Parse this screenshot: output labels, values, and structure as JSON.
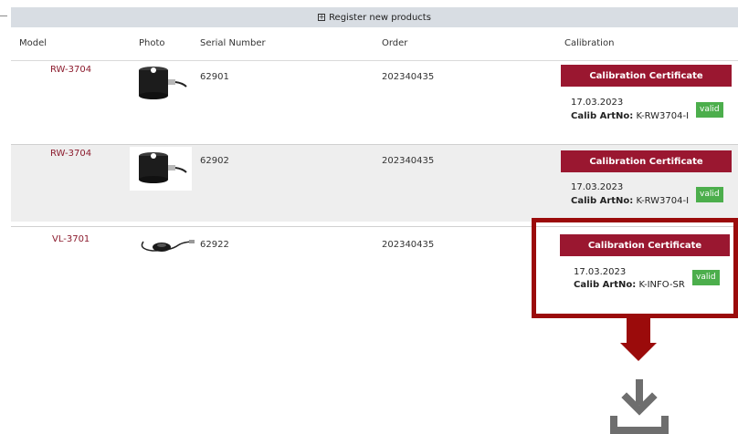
{
  "register": {
    "label": "Register new products",
    "icon": "plus-box-icon"
  },
  "columns": {
    "model": "Model",
    "photo": "Photo",
    "serial": "Serial Number",
    "order": "Order",
    "calibration": "Calibration"
  },
  "rows": [
    {
      "model": "RW-3704",
      "serial": "62901",
      "order": "202340435",
      "cert_label": "Calibration Certificate",
      "cal_date": "17.03.2023",
      "art_label": "Calib ArtNo:",
      "art_no": "K-RW3704-I",
      "status": "valid",
      "photo": "sensor-cylinder-photo"
    },
    {
      "model": "RW-3704",
      "serial": "62902",
      "order": "202340435",
      "cert_label": "Calibration Certificate",
      "cal_date": "17.03.2023",
      "art_label": "Calib ArtNo:",
      "art_no": "K-RW3704-I",
      "status": "valid",
      "photo": "sensor-cylinder-photo"
    },
    {
      "model": "VL-3701",
      "serial": "62922",
      "order": "202340435",
      "cert_label": "Calibration Certificate",
      "cal_date": "17.03.2023",
      "art_label": "Calib ArtNo:",
      "art_no": "K-INFO-SR",
      "status": "valid",
      "photo": "sensor-disc-cable-photo"
    }
  ],
  "colors": {
    "accent": "#9a1730",
    "model_link": "#8c1c2e",
    "valid": "#4cae4c",
    "annotation": "#9b0b0b",
    "header_bar": "#d8dde3"
  },
  "annotation": {
    "arrow": "down-arrow-icon",
    "target_icon": "download-icon"
  }
}
